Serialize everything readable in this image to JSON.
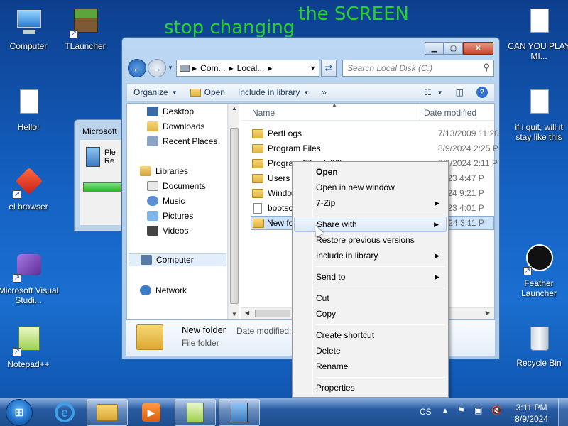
{
  "desktop": {
    "overlay_text_1": "stop changing",
    "overlay_text_2": "the SCREEN",
    "icons": {
      "computer": "Computer",
      "tlauncher": "TLauncher",
      "hello": "Hello!",
      "el_browser": "el browser",
      "visual_studio": "Microsoft Visual Studi...",
      "notepadpp": "Notepad++",
      "can_you": "CAN YOU PLAY MI...",
      "if_i_quit": "if i quit, will it stay like this",
      "feather": "Feather Launcher",
      "recycle": "Recycle Bin"
    }
  },
  "dialog": {
    "title": "Microsoft",
    "line1": "Ple",
    "line2": "Re"
  },
  "explorer": {
    "address_parts": [
      "Com...",
      "Local..."
    ],
    "search_placeholder": "Search Local Disk (C:)",
    "toolbar": {
      "organize": "Organize",
      "open": "Open",
      "include": "Include in library",
      "more": "»"
    },
    "nav": {
      "desktop": "Desktop",
      "downloads": "Downloads",
      "recent": "Recent Places",
      "libraries": "Libraries",
      "documents": "Documents",
      "music": "Music",
      "pictures": "Pictures",
      "videos": "Videos",
      "computer": "Computer",
      "network": "Network"
    },
    "columns": {
      "name": "Name",
      "date": "Date modified"
    },
    "files": [
      {
        "name": "PerfLogs",
        "date": "7/13/2009 11:20"
      },
      {
        "name": "Program Files",
        "date": "8/9/2024 2:25 P"
      },
      {
        "name": "Program Files (x86)",
        "date": "8/9/2024 2:11 P"
      },
      {
        "name": "Users",
        "date": "2023 4:47 P"
      },
      {
        "name": "Windo",
        "date": "2024 9:21 P"
      },
      {
        "name": "bootsc",
        "date": "2023 4:01 P"
      },
      {
        "name": "New fo",
        "date": "2024 3:11 P"
      }
    ],
    "details": {
      "name": "New folder",
      "date_label": "Date modified:",
      "type": "File folder"
    }
  },
  "context_menu": {
    "open": "Open",
    "open_new_window": "Open in new window",
    "zip": "7-Zip",
    "share_with": "Share with",
    "restore": "Restore previous versions",
    "include": "Include in library",
    "send_to": "Send to",
    "cut": "Cut",
    "copy": "Copy",
    "create_shortcut": "Create shortcut",
    "delete": "Delete",
    "rename": "Rename",
    "properties": "Properties"
  },
  "taskbar": {
    "lang": "CS",
    "time": "3:11 PM",
    "date": "8/9/2024"
  },
  "colors": {
    "desktop_bg": "#1462c4",
    "overlay_text": "#2ad12a",
    "menu_bg": "#f2f2f2",
    "highlight": "#cde3fb"
  }
}
